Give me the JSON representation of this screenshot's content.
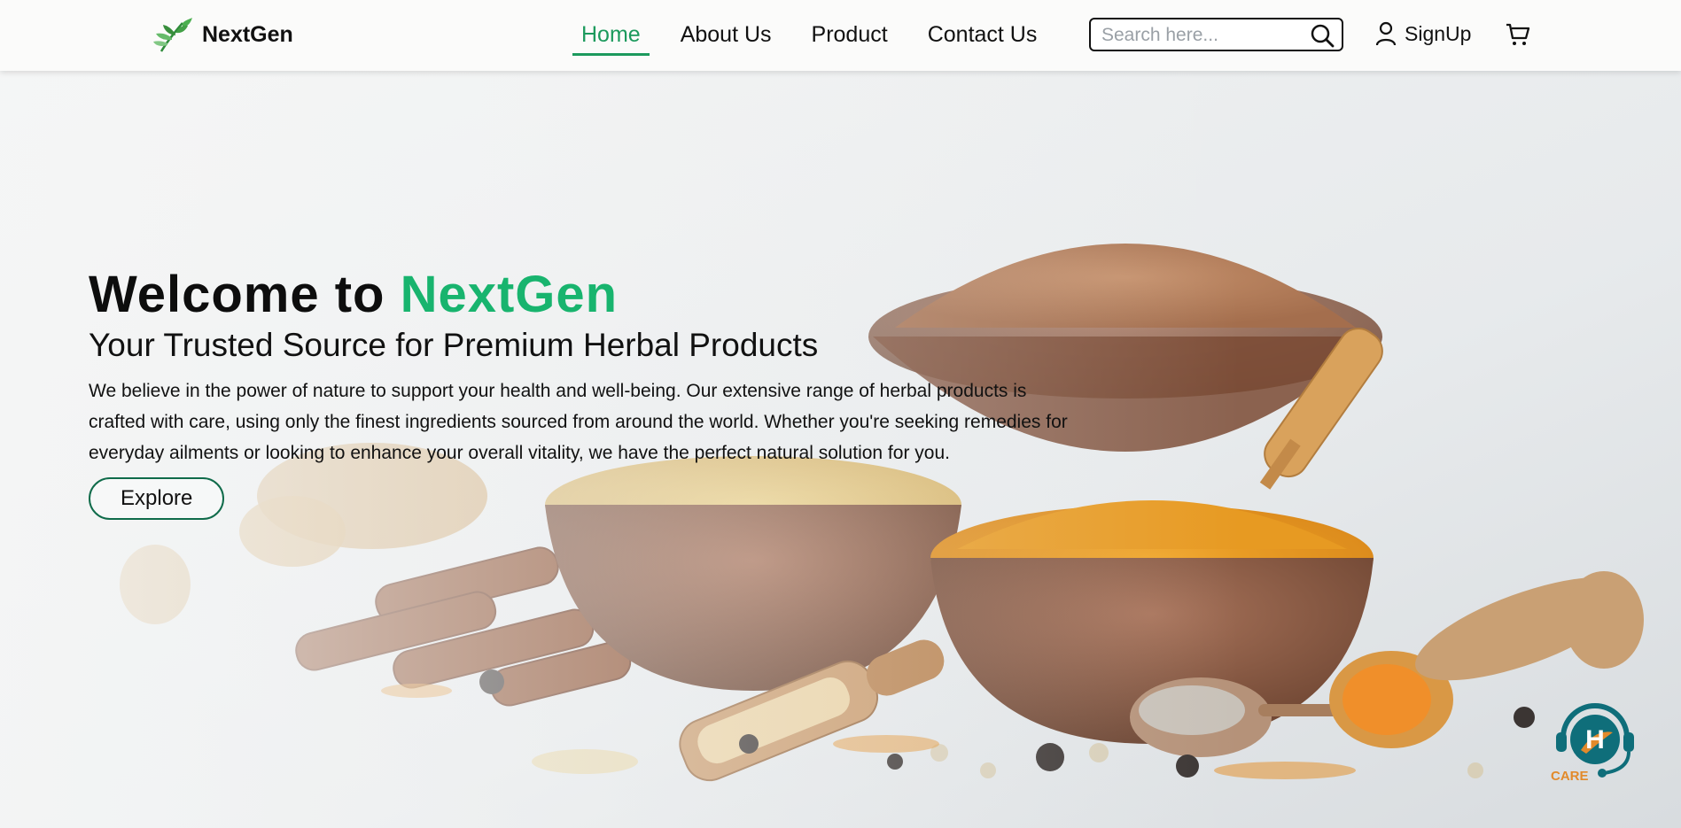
{
  "header": {
    "brand": "NextGen",
    "nav": [
      "Home",
      "About Us",
      "Product",
      "Contact Us"
    ],
    "search_placeholder": "Search here...",
    "signup_label": "SignUp"
  },
  "hero": {
    "title_prefix": "Welcome to",
    "title_brand": "NextGen",
    "subtitle": "Your Trusted Source for Premium Herbal Products",
    "paragraph": "We believe in the power of nature to support your health and well-being. Our extensive range of herbal products is crafted with care, using only the finest ingredients sourced from around the world. Whether you're seeking remedies for everyday ailments or looking to enhance your overall vitality, we have the perfect natural solution for you.",
    "cta_label": "Explore"
  },
  "care_badge": {
    "letter": "H",
    "label": "CARE"
  },
  "icons": [
    "leaf-logo-icon",
    "search-icon",
    "user-icon",
    "cart-icon",
    "support-headset-icon"
  ],
  "colors": {
    "accent": "#1c9a5d",
    "brand_green": "#18b46e",
    "cta_border": "#0f6b4a",
    "care_teal": "#0f6e7a",
    "care_orange": "#e28a2b"
  }
}
